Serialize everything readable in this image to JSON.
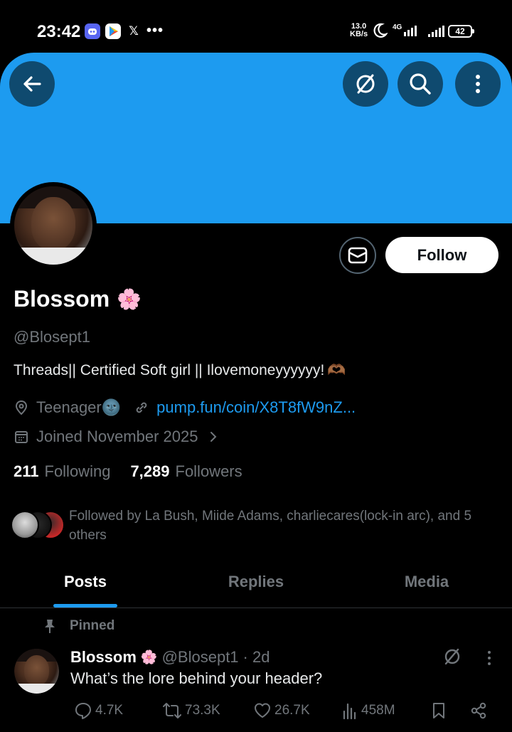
{
  "status_bar": {
    "time": "23:42",
    "net_speed_value": "13.0",
    "net_speed_unit": "KB/s",
    "network": "4G",
    "battery": "42",
    "icons": [
      "discord-icon",
      "play-store-icon",
      "x-icon",
      "more-dots-icon",
      "moon-icon",
      "signal-icon",
      "battery-icon"
    ]
  },
  "header": {
    "banner_color": "#1d9bf0",
    "buttons": [
      "back-arrow-icon",
      "grok-icon",
      "search-icon",
      "more-vertical-icon"
    ]
  },
  "profile": {
    "name": "Blossom",
    "name_emoji": "🌸",
    "handle": "@Blosept1",
    "bio": "Threads|| Certified Soft girl || Ilovemoneyyyyyy!",
    "bio_emoji": "🫶🏾",
    "location": "Teenager",
    "location_emoji": "🌚",
    "website": "pump.fun/coin/X8T8fW9nZ...",
    "joined": "Joined November 2025",
    "following_count": "211",
    "following_label": "Following",
    "followers_count": "7,289",
    "followers_label": "Followers",
    "followed_by": "Followed by La Bush, Miide Adams, charliecares(lock-in arc), and 5 others",
    "follow_button": "Follow"
  },
  "tabs": [
    {
      "label": "Posts",
      "active": true
    },
    {
      "label": "Replies",
      "active": false
    },
    {
      "label": "Media",
      "active": false
    }
  ],
  "post": {
    "pinned_label": "Pinned",
    "author_name": "Blossom",
    "author_emoji": "🌸",
    "author_handle": "@Blosept1",
    "time": "· 2d",
    "text": "What’s the lore behind your header?",
    "replies": "4.7K",
    "reposts": "73.3K",
    "likes": "26.7K",
    "views": "458M"
  },
  "colors": {
    "accent": "#1d9bf0",
    "muted": "#71767b",
    "background": "#000000"
  }
}
